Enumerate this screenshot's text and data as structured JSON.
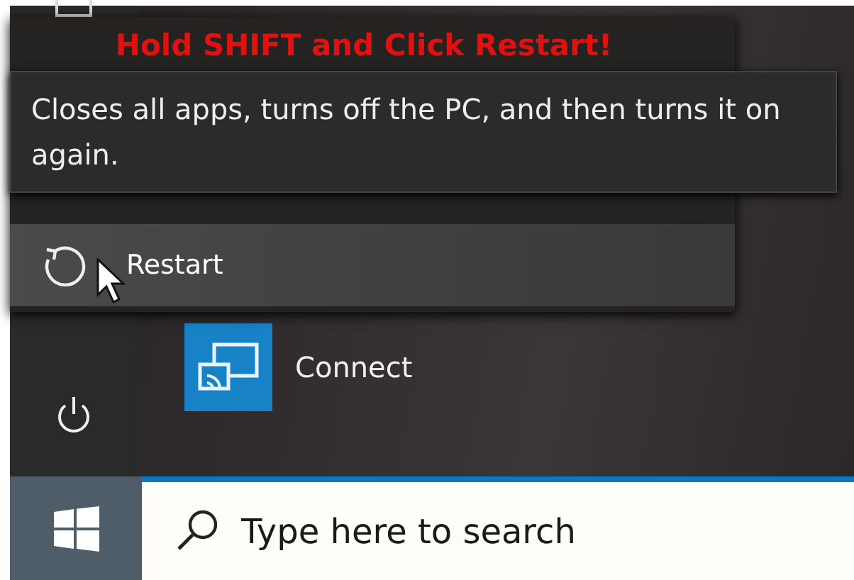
{
  "annotation": "Hold SHIFT and Click Restart!",
  "tooltip": "Closes all apps, turns off the PC, and then turns it on again.",
  "power_menu": {
    "items": [
      {
        "label": "Restart",
        "selected": true
      }
    ]
  },
  "tiles": [
    {
      "label": "Connect"
    }
  ],
  "taskbar": {
    "search": {
      "placeholder": "Type here to search"
    }
  }
}
